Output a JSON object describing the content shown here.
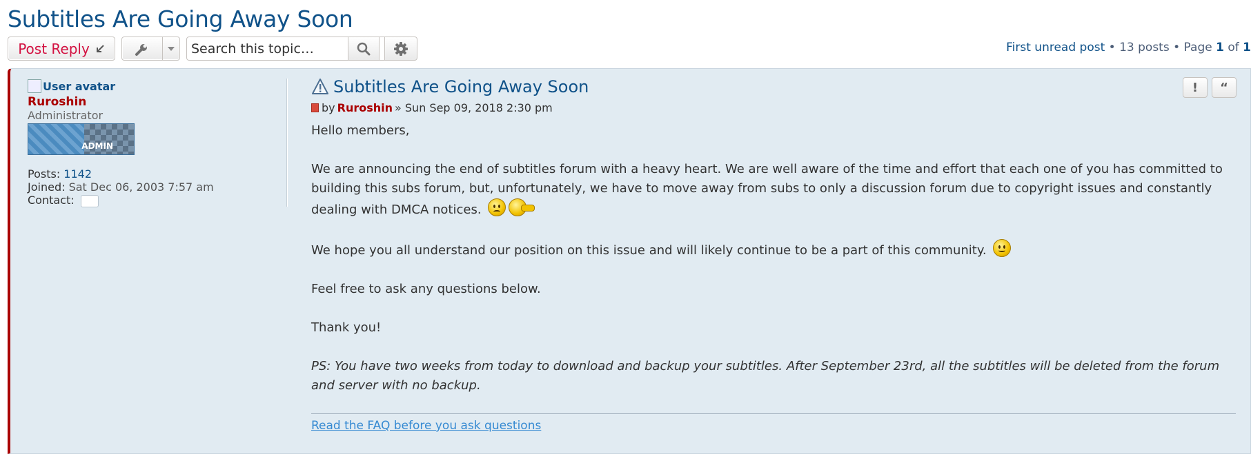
{
  "topic": {
    "title": "Subtitles Are Going Away Soon"
  },
  "toolbar": {
    "post_reply_label": "Post Reply",
    "search_placeholder": "Search this topic…"
  },
  "pagination": {
    "first_unread": "First unread post",
    "sep": " • ",
    "posts_count": "13 posts",
    "page_prefix": "Page ",
    "page_current": "1",
    "page_of": " of ",
    "page_total": "1"
  },
  "post": {
    "avatar_alt": "User avatar",
    "username": "Ruroshin",
    "rank": "Administrator",
    "rank_image_label": "ADMIN",
    "posts_label": "Posts:",
    "posts_value": "1142",
    "joined_label": "Joined:",
    "joined_value": "Sat Dec 06, 2003 7:57 am",
    "contact_label": "Contact:",
    "title": "Subtitles Are Going Away Soon",
    "by_label": "by",
    "author": "Ruroshin",
    "date": "» Sun Sep 09, 2018 2:30 pm",
    "paragraphs": [
      "Hello members,",
      "We are announcing the end of subtitles forum with a heavy heart. We are well aware of the time and effort that each one of you has committed to building this subs forum, but, unfortunately, we have to move away from subs to only a discussion forum due to copyright issues and constantly dealing with DMCA notices.",
      "We hope you all understand our position on this issue and will likely continue to be a part of this community.",
      "Feel free to ask any questions below.",
      "Thank you!",
      "PS: You have two weeks from today to download and backup your subtitles. After September 23rd, all the subtitles will be deleted from the forum and server with no backup."
    ],
    "signature_link": "Read the FAQ before you ask questions",
    "report_label": "!",
    "quote_label": "“"
  },
  "colors": {
    "link": "#105289",
    "post_bg": "#e1ebf2",
    "admin_name": "#aa0000",
    "reply_text": "#d31141"
  },
  "icons": [
    "reply-arrow-icon",
    "wrench-icon",
    "chevron-down-icon",
    "search-icon",
    "gear-icon",
    "warning-icon",
    "post-file-icon",
    "contact-icon",
    "sad-smiley-icon",
    "pointing-smiley-icon",
    "smile-smiley-icon"
  ]
}
